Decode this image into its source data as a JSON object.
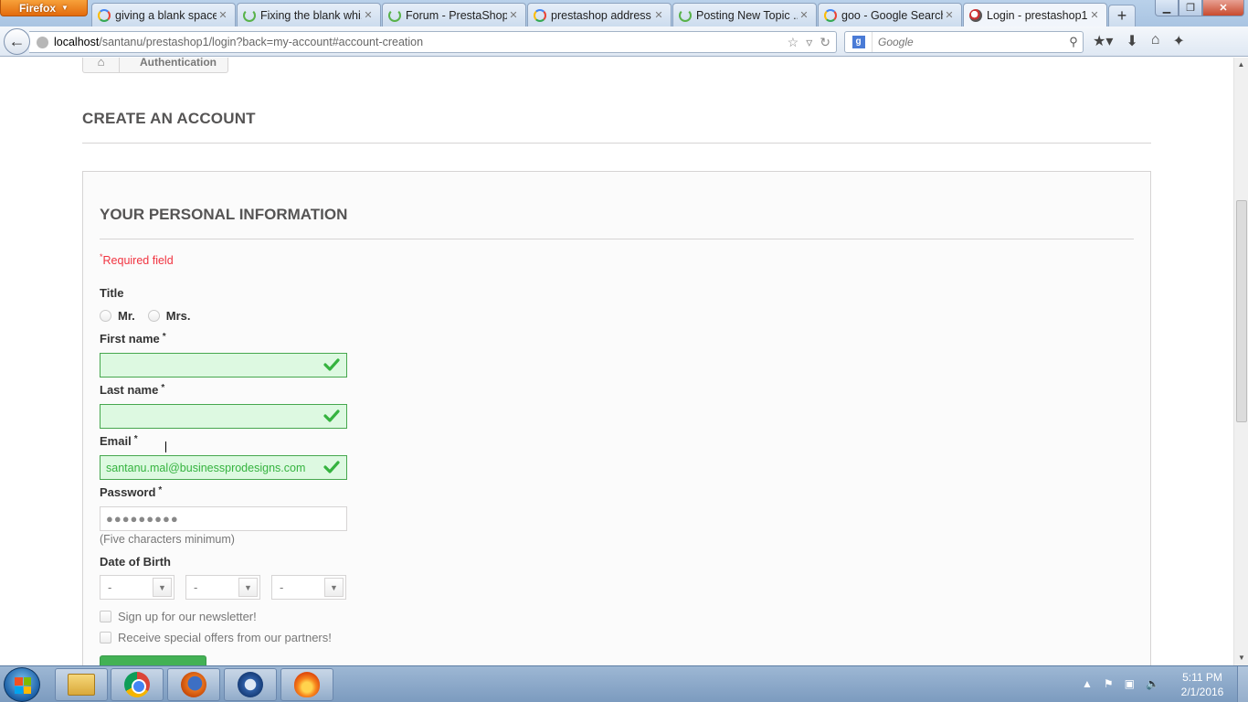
{
  "browser": {
    "menu_button": "Firefox",
    "tabs": [
      {
        "title": "giving a blank space...",
        "favicon": "google-g"
      },
      {
        "title": "Fixing the blank whi...",
        "favicon": "loading"
      },
      {
        "title": "Forum - PrestaShop",
        "favicon": "loading"
      },
      {
        "title": "prestashop address ...",
        "favicon": "google-g"
      },
      {
        "title": "Posting New Topic ...",
        "favicon": "loading"
      },
      {
        "title": "goo - Google Search",
        "favicon": "google-g"
      },
      {
        "title": "Login - prestashop1",
        "favicon": "prestashop",
        "active": true
      }
    ],
    "url_host": "localhost",
    "url_path": "/santanu/prestashop1/login?back=my-account#account-creation",
    "search_placeholder": "Google"
  },
  "breadcrumb": {
    "current": "Authentication"
  },
  "page": {
    "heading": "CREATE AN ACCOUNT",
    "section_heading": "YOUR PERSONAL INFORMATION",
    "required_note": "Required field",
    "required_mark": "*",
    "title_label": "Title",
    "title_options": [
      "Mr.",
      "Mrs."
    ],
    "first_name_label": "First name",
    "first_name_value": "",
    "last_name_label": "Last name",
    "last_name_value": "",
    "email_label": "Email",
    "email_value": "santanu.mal@businessprodesigns.com",
    "password_label": "Password",
    "password_mask": "●●●●●●●●●",
    "password_help": "(Five characters minimum)",
    "dob_label": "Date of Birth",
    "dob_day": "-",
    "dob_month": "-",
    "dob_year": "-",
    "newsletter_label": "Sign up for our newsletter!",
    "optin_label": "Receive special offers from our partners!"
  },
  "colors": {
    "valid_bg": "#ddf9e1",
    "valid_border": "#46a74e",
    "valid_text": "#35b33f",
    "required_red": "#f13340",
    "submit_green": "#43b155"
  },
  "taskbar": {
    "clock_time": "5:11 PM",
    "clock_date": "2/1/2016",
    "apps": [
      "explorer-icon",
      "chrome-icon",
      "firefox-icon",
      "thunderbird-icon",
      "flame-app-icon"
    ]
  }
}
